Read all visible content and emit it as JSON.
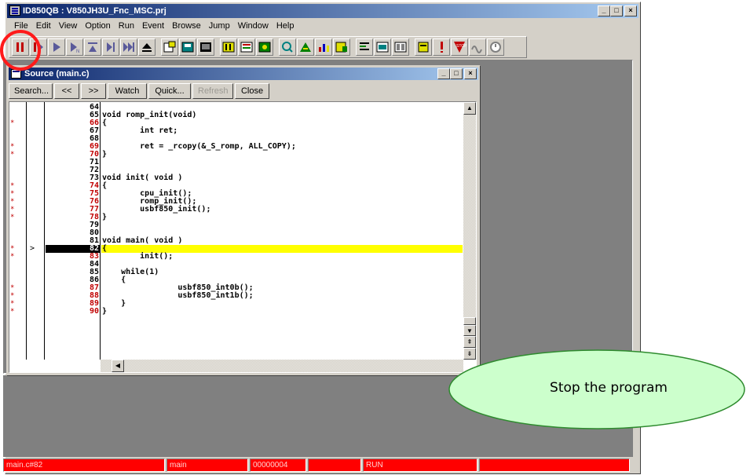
{
  "window": {
    "title": "ID850QB : V850JH3U_Fnc_MSC.prj",
    "min": "_",
    "max": "□",
    "close": "×"
  },
  "menu": [
    "File",
    "Edit",
    "View",
    "Option",
    "Run",
    "Event",
    "Browse",
    "Jump",
    "Window",
    "Help"
  ],
  "toolbar": {
    "icons": [
      "stop-icon",
      "reset-icon",
      "run-icon",
      "run-no-break-icon",
      "step-in-icon",
      "step-over-icon",
      "return-out-icon",
      "restart-icon",
      "open-file-icon",
      "save-icon",
      "load-icon",
      "memory-icon",
      "register-icon",
      "watch-icon",
      "search-icon",
      "trace-icon",
      "coverage-icon",
      "event-icon",
      "source-icon",
      "assemble-icon",
      "io-icon",
      "stack-icon",
      "alert-icon",
      "break-icon",
      "wave-icon",
      "timer-icon"
    ]
  },
  "source_window": {
    "title": "Source (main.c)",
    "buttons": {
      "search": "Search...",
      "back": "<<",
      "forward": ">>",
      "watch": "Watch",
      "quick": "Quick...",
      "refresh": "Refresh",
      "close": "Close"
    },
    "lines": [
      {
        "n": "64",
        "text": "",
        "bp": false,
        "red": false
      },
      {
        "n": "65",
        "text": "void romp_init(void)",
        "bp": false,
        "red": false
      },
      {
        "n": "66",
        "text": "{",
        "bp": true,
        "red": true
      },
      {
        "n": "67",
        "text": "        int ret;",
        "bp": false,
        "red": false
      },
      {
        "n": "68",
        "text": "",
        "bp": false,
        "red": false
      },
      {
        "n": "69",
        "text": "        ret = _rcopy(&_S_romp, ALL_COPY);",
        "bp": true,
        "red": true
      },
      {
        "n": "70",
        "text": "}",
        "bp": true,
        "red": true
      },
      {
        "n": "71",
        "text": "",
        "bp": false,
        "red": false
      },
      {
        "n": "72",
        "text": "",
        "bp": false,
        "red": false
      },
      {
        "n": "73",
        "text": "void init( void )",
        "bp": false,
        "red": false
      },
      {
        "n": "74",
        "text": "{",
        "bp": true,
        "red": true
      },
      {
        "n": "75",
        "text": "        cpu_init();",
        "bp": true,
        "red": true
      },
      {
        "n": "76",
        "text": "        romp_init();",
        "bp": true,
        "red": true
      },
      {
        "n": "77",
        "text": "        usbf850_init();",
        "bp": true,
        "red": true
      },
      {
        "n": "78",
        "text": "}",
        "bp": true,
        "red": true
      },
      {
        "n": "79",
        "text": "",
        "bp": false,
        "red": false
      },
      {
        "n": "80",
        "text": "",
        "bp": false,
        "red": false
      },
      {
        "n": "81",
        "text": "void main( void )",
        "bp": false,
        "red": false
      },
      {
        "n": "82",
        "text": "{",
        "bp": true,
        "red": false,
        "current": true,
        "ptr": ">"
      },
      {
        "n": "83",
        "text": "        init();",
        "bp": true,
        "red": true
      },
      {
        "n": "84",
        "text": "",
        "bp": false,
        "red": false
      },
      {
        "n": "85",
        "text": "    while(1)",
        "bp": false,
        "red": false
      },
      {
        "n": "86",
        "text": "    {",
        "bp": false,
        "red": false
      },
      {
        "n": "87",
        "text": "                usbf850_int0b();",
        "bp": true,
        "red": true
      },
      {
        "n": "88",
        "text": "                usbf850_int1b();",
        "bp": true,
        "red": true
      },
      {
        "n": "89",
        "text": "    }",
        "bp": true,
        "red": true
      },
      {
        "n": "90",
        "text": "}",
        "bp": true,
        "red": true
      }
    ]
  },
  "status": {
    "location": "main.c#82",
    "function": "main",
    "address": "00000004",
    "field4": "",
    "state": "RUN",
    "field6": ""
  },
  "callout": {
    "text": "Stop the program"
  },
  "colors": {
    "status_bg": "#ff0000",
    "current_line": "#ffff00",
    "callout_fill": "#ccffcc",
    "callout_border": "#2e8b2e",
    "highlight_ring": "#ff1a1a"
  }
}
